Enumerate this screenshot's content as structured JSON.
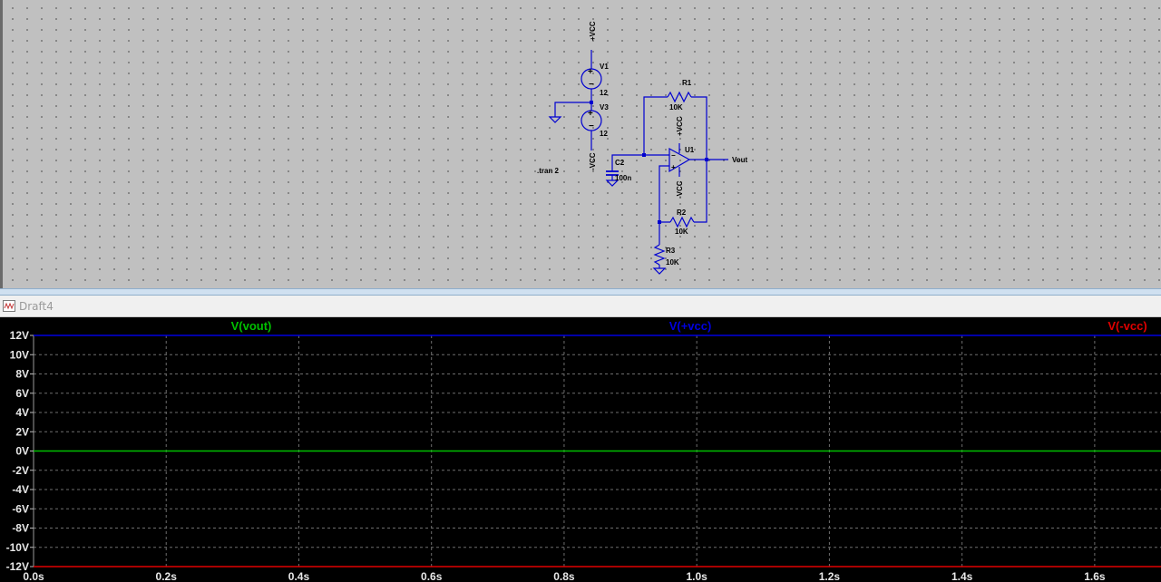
{
  "window": {
    "title": "Draft4"
  },
  "schematic": {
    "directive": ".tran 2",
    "components": {
      "V1": {
        "name": "V1",
        "value": "12"
      },
      "V3": {
        "name": "V3",
        "value": "12"
      },
      "R1": {
        "name": "R1",
        "value": "10K"
      },
      "R2": {
        "name": "R2",
        "value": "10K"
      },
      "R3": {
        "name": "R3",
        "value": "10K"
      },
      "C2": {
        "name": "C2",
        "value": "100n"
      },
      "U1": {
        "name": "U1"
      }
    },
    "nets": {
      "vcc_pos": "+VCC",
      "vcc_neg": "-VCC",
      "out": "Vout"
    }
  },
  "chart_data": {
    "type": "line",
    "xlabel": "",
    "ylabel": "",
    "xlim": [
      0,
      1.7
    ],
    "ylim": [
      -12,
      12
    ],
    "x_ticks": [
      {
        "v": 0.0,
        "label": "0.0s"
      },
      {
        "v": 0.2,
        "label": "0.2s"
      },
      {
        "v": 0.4,
        "label": "0.4s"
      },
      {
        "v": 0.6,
        "label": "0.6s"
      },
      {
        "v": 0.8,
        "label": "0.8s"
      },
      {
        "v": 1.0,
        "label": "1.0s"
      },
      {
        "v": 1.2,
        "label": "1.2s"
      },
      {
        "v": 1.4,
        "label": "1.4s"
      },
      {
        "v": 1.6,
        "label": "1.6s"
      }
    ],
    "y_ticks": [
      {
        "v": 12,
        "label": "12V"
      },
      {
        "v": 10,
        "label": "10V"
      },
      {
        "v": 8,
        "label": "8V"
      },
      {
        "v": 6,
        "label": "6V"
      },
      {
        "v": 4,
        "label": "4V"
      },
      {
        "v": 2,
        "label": "2V"
      },
      {
        "v": 0,
        "label": "0V"
      },
      {
        "v": -2,
        "label": "-2V"
      },
      {
        "v": -4,
        "label": "-4V"
      },
      {
        "v": -6,
        "label": "-6V"
      },
      {
        "v": -8,
        "label": "-8V"
      },
      {
        "v": -10,
        "label": "-10V"
      },
      {
        "v": -12,
        "label": "-12V"
      }
    ],
    "grid": true,
    "series": [
      {
        "name": "V(vout)",
        "color": "#00c000",
        "x": [
          0,
          1.7
        ],
        "y": [
          0,
          0
        ]
      },
      {
        "name": "V(+vcc)",
        "color": "#0000e0",
        "x": [
          0,
          1.7
        ],
        "y": [
          12,
          12
        ]
      },
      {
        "name": "V(-vcc)",
        "color": "#e00000",
        "x": [
          0,
          1.7
        ],
        "y": [
          -12,
          -12
        ]
      }
    ]
  }
}
